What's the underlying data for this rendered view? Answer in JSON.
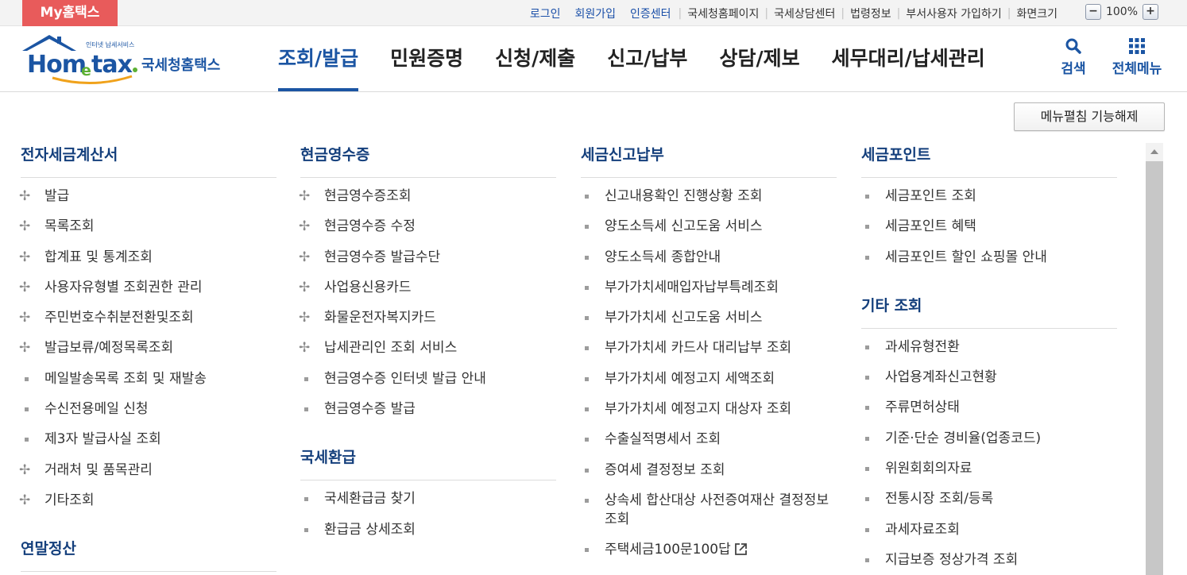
{
  "topbar": {
    "my_tab": "My홈택스",
    "links_blue": [
      "로그인",
      "회원가입",
      "인증센터"
    ],
    "links": [
      "국세청홈페이지",
      "국세상담센터",
      "법령정보",
      "부서사용자 가입하기"
    ],
    "zoom_label": "화면크기",
    "zoom_value": "100%",
    "zoom_minus": "−",
    "zoom_plus": "+"
  },
  "header": {
    "logo_small": "인터넷 납세서비스",
    "logo_text": "Hometax",
    "logo_korean": "국세청홈택스",
    "nav": [
      "조회/발급",
      "민원증명",
      "신청/제출",
      "신고/납부",
      "상담/제보",
      "세무대리/납세관리"
    ],
    "active_nav": "조회/발급",
    "search_label": "검색",
    "all_menu_label": "전체메뉴"
  },
  "fold_button": "메뉴펼침 기능해제",
  "columns": [
    {
      "sections": [
        {
          "title": "전자세금계산서",
          "items": [
            {
              "label": "발급",
              "marker": "plus"
            },
            {
              "label": "목록조회",
              "marker": "plus"
            },
            {
              "label": "합계표 및 통계조회",
              "marker": "plus"
            },
            {
              "label": "사용자유형별 조회권한 관리",
              "marker": "plus"
            },
            {
              "label": "주민번호수취분전환및조회",
              "marker": "plus"
            },
            {
              "label": "발급보류/예정목록조회",
              "marker": "plus"
            },
            {
              "label": "메일발송목록 조회 및 재발송",
              "marker": "square"
            },
            {
              "label": "수신전용메일 신청",
              "marker": "square"
            },
            {
              "label": "제3자 발급사실 조회",
              "marker": "square"
            },
            {
              "label": "거래처 및 품목관리",
              "marker": "plus"
            },
            {
              "label": "기타조회",
              "marker": "plus"
            }
          ]
        },
        {
          "title": "연말정산",
          "items": []
        }
      ]
    },
    {
      "sections": [
        {
          "title": "현금영수증",
          "items": [
            {
              "label": "현금영수증조회",
              "marker": "plus"
            },
            {
              "label": "현금영수증 수정",
              "marker": "plus"
            },
            {
              "label": "현금영수증 발급수단",
              "marker": "plus"
            },
            {
              "label": "사업용신용카드",
              "marker": "plus"
            },
            {
              "label": "화물운전자복지카드",
              "marker": "plus"
            },
            {
              "label": "납세관리인 조회 서비스",
              "marker": "plus"
            },
            {
              "label": "현금영수증 인터넷 발급 안내",
              "marker": "square"
            },
            {
              "label": "현금영수증 발급",
              "marker": "square"
            }
          ]
        },
        {
          "title": "국세환급",
          "items": [
            {
              "label": "국세환급금 찾기",
              "marker": "square"
            },
            {
              "label": "환급금 상세조회",
              "marker": "square"
            }
          ]
        }
      ]
    },
    {
      "sections": [
        {
          "title": "세금신고납부",
          "items": [
            {
              "label": "신고내용확인 진행상황 조회",
              "marker": "square"
            },
            {
              "label": "양도소득세 신고도움 서비스",
              "marker": "square"
            },
            {
              "label": "양도소득세 종합안내",
              "marker": "square"
            },
            {
              "label": "부가가치세매입자납부특례조회",
              "marker": "square"
            },
            {
              "label": "부가가치세 신고도움 서비스",
              "marker": "square"
            },
            {
              "label": "부가가치세 카드사 대리납부 조회",
              "marker": "square"
            },
            {
              "label": "부가가치세 예정고지 세액조회",
              "marker": "square"
            },
            {
              "label": "부가가치세 예정고지 대상자 조회",
              "marker": "square"
            },
            {
              "label": "수출실적명세서 조회",
              "marker": "square"
            },
            {
              "label": "증여세 결정정보 조회",
              "marker": "square"
            },
            {
              "label": "상속세 합산대상 사전증여재산 결정정보 조회",
              "marker": "square"
            },
            {
              "label": "주택세금100문100답",
              "marker": "square",
              "external": true
            }
          ]
        }
      ]
    },
    {
      "sections": [
        {
          "title": "세금포인트",
          "items": [
            {
              "label": "세금포인트 조회",
              "marker": "square"
            },
            {
              "label": "세금포인트 혜택",
              "marker": "square"
            },
            {
              "label": "세금포인트 할인 쇼핑몰 안내",
              "marker": "square"
            }
          ]
        },
        {
          "title": "기타 조회",
          "items": [
            {
              "label": "과세유형전환",
              "marker": "square"
            },
            {
              "label": "사업용계좌신고현황",
              "marker": "square"
            },
            {
              "label": "주류면허상태",
              "marker": "square"
            },
            {
              "label": "기준·단순 경비율(업종코드)",
              "marker": "square"
            },
            {
              "label": "위원회회의자료",
              "marker": "square"
            },
            {
              "label": "전통시장 조회/등록",
              "marker": "square"
            },
            {
              "label": "과세자료조회",
              "marker": "square"
            },
            {
              "label": "지급보증 정상가격 조회",
              "marker": "square"
            }
          ]
        }
      ]
    }
  ]
}
